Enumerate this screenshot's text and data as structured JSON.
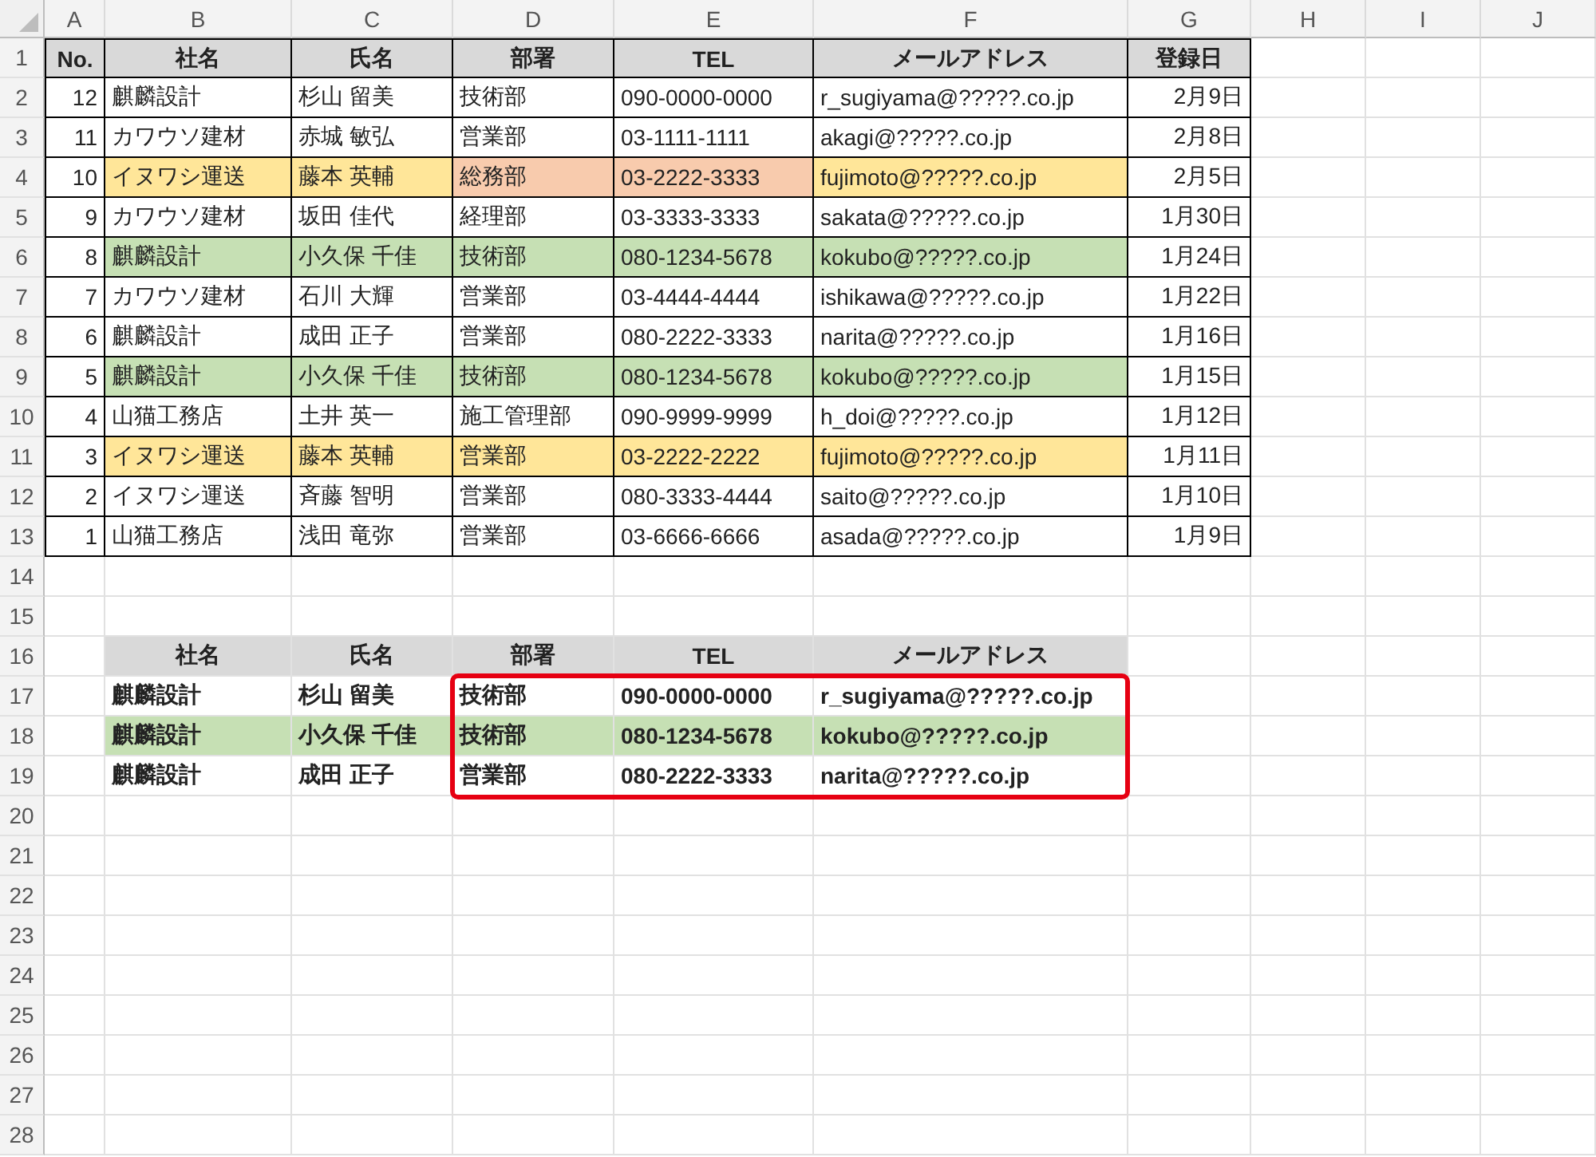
{
  "column_headers": [
    "A",
    "B",
    "C",
    "D",
    "E",
    "F",
    "G",
    "H",
    "I",
    "J"
  ],
  "row_headers": [
    "1",
    "2",
    "3",
    "4",
    "5",
    "6",
    "7",
    "8",
    "9",
    "10",
    "11",
    "12",
    "13",
    "14",
    "15",
    "16",
    "17",
    "18",
    "19",
    "20",
    "21",
    "22",
    "23",
    "24",
    "25",
    "26",
    "27",
    "28"
  ],
  "table_1": {
    "header": [
      "No.",
      "社名",
      "氏名",
      "部署",
      "TEL",
      "メールアドレス",
      "登録日"
    ],
    "rows": [
      {
        "cells": [
          {
            "text": "12"
          },
          {
            "text": "麒麟設計"
          },
          {
            "text": "杉山 留美"
          },
          {
            "text": "技術部"
          },
          {
            "text": "090-0000-0000"
          },
          {
            "text": "r_sugiyama@?????.co.jp"
          },
          {
            "text": "2月9日"
          }
        ]
      },
      {
        "cells": [
          {
            "text": "11"
          },
          {
            "text": "カワウソ建材"
          },
          {
            "text": "赤城 敏弘"
          },
          {
            "text": "営業部"
          },
          {
            "text": "03-1111-1111"
          },
          {
            "text": "akagi@?????.co.jp"
          },
          {
            "text": "2月8日"
          }
        ]
      },
      {
        "cells": [
          {
            "text": "10"
          },
          {
            "text": "イヌワシ運送",
            "color": "#ffe699"
          },
          {
            "text": "藤本 英輔",
            "color": "#ffe699"
          },
          {
            "text": "総務部",
            "color": "#f8cbad"
          },
          {
            "text": "03-2222-3333",
            "color": "#f8cbad"
          },
          {
            "text": "fujimoto@?????.co.jp",
            "color": "#ffe699"
          },
          {
            "text": "2月5日"
          }
        ]
      },
      {
        "cells": [
          {
            "text": "9"
          },
          {
            "text": "カワウソ建材"
          },
          {
            "text": "坂田 佳代"
          },
          {
            "text": "経理部"
          },
          {
            "text": "03-3333-3333"
          },
          {
            "text": "sakata@?????.co.jp"
          },
          {
            "text": "1月30日"
          }
        ]
      },
      {
        "cells": [
          {
            "text": "8"
          },
          {
            "text": "麒麟設計",
            "color": "#c6e0b4"
          },
          {
            "text": "小久保 千佳",
            "color": "#c6e0b4"
          },
          {
            "text": "技術部",
            "color": "#c6e0b4"
          },
          {
            "text": "080-1234-5678",
            "color": "#c6e0b4"
          },
          {
            "text": "kokubo@?????.co.jp",
            "color": "#c6e0b4"
          },
          {
            "text": "1月24日"
          }
        ]
      },
      {
        "cells": [
          {
            "text": "7"
          },
          {
            "text": "カワウソ建材"
          },
          {
            "text": "石川 大輝"
          },
          {
            "text": "営業部"
          },
          {
            "text": "03-4444-4444"
          },
          {
            "text": "ishikawa@?????.co.jp"
          },
          {
            "text": "1月22日"
          }
        ]
      },
      {
        "cells": [
          {
            "text": "6"
          },
          {
            "text": "麒麟設計"
          },
          {
            "text": "成田 正子"
          },
          {
            "text": "営業部"
          },
          {
            "text": "080-2222-3333"
          },
          {
            "text": "narita@?????.co.jp"
          },
          {
            "text": "1月16日"
          }
        ]
      },
      {
        "cells": [
          {
            "text": "5"
          },
          {
            "text": "麒麟設計",
            "color": "#c6e0b4"
          },
          {
            "text": "小久保 千佳",
            "color": "#c6e0b4"
          },
          {
            "text": "技術部",
            "color": "#c6e0b4"
          },
          {
            "text": "080-1234-5678",
            "color": "#c6e0b4"
          },
          {
            "text": "kokubo@?????.co.jp",
            "color": "#c6e0b4"
          },
          {
            "text": "1月15日"
          }
        ]
      },
      {
        "cells": [
          {
            "text": "4"
          },
          {
            "text": "山猫工務店"
          },
          {
            "text": "土井 英一"
          },
          {
            "text": "施工管理部"
          },
          {
            "text": "090-9999-9999"
          },
          {
            "text": "h_doi@?????.co.jp"
          },
          {
            "text": "1月12日"
          }
        ]
      },
      {
        "cells": [
          {
            "text": "3"
          },
          {
            "text": "イヌワシ運送",
            "color": "#ffe699"
          },
          {
            "text": "藤本 英輔",
            "color": "#ffe699"
          },
          {
            "text": "営業部",
            "color": "#ffe699"
          },
          {
            "text": "03-2222-2222",
            "color": "#ffe699"
          },
          {
            "text": "fujimoto@?????.co.jp",
            "color": "#ffe699"
          },
          {
            "text": "1月11日"
          }
        ]
      },
      {
        "cells": [
          {
            "text": "2"
          },
          {
            "text": "イヌワシ運送"
          },
          {
            "text": "斉藤 智明"
          },
          {
            "text": "営業部"
          },
          {
            "text": "080-3333-4444"
          },
          {
            "text": "saito@?????.co.jp"
          },
          {
            "text": "1月10日"
          }
        ]
      },
      {
        "cells": [
          {
            "text": "1"
          },
          {
            "text": "山猫工務店"
          },
          {
            "text": "浅田 竜弥"
          },
          {
            "text": "営業部"
          },
          {
            "text": "03-6666-6666"
          },
          {
            "text": "asada@?????.co.jp"
          },
          {
            "text": "1月9日"
          }
        ]
      }
    ]
  },
  "table_2": {
    "header": [
      "社名",
      "氏名",
      "部署",
      "TEL",
      "メールアドレス"
    ],
    "rows": [
      {
        "cells": [
          {
            "text": "麒麟設計"
          },
          {
            "text": "杉山 留美"
          },
          {
            "text": "技術部"
          },
          {
            "text": "090-0000-0000"
          },
          {
            "text": "r_sugiyama@?????.co.jp"
          }
        ]
      },
      {
        "cells": [
          {
            "text": "麒麟設計",
            "color": "#c6e0b4"
          },
          {
            "text": "小久保 千佳",
            "color": "#c6e0b4"
          },
          {
            "text": "技術部",
            "color": "#c6e0b4"
          },
          {
            "text": "080-1234-5678",
            "color": "#c6e0b4"
          },
          {
            "text": "kokubo@?????.co.jp",
            "color": "#c6e0b4"
          }
        ]
      },
      {
        "cells": [
          {
            "text": "麒麟設計"
          },
          {
            "text": "成田 正子"
          },
          {
            "text": "営業部"
          },
          {
            "text": "080-2222-3333"
          },
          {
            "text": "narita@?????.co.jp"
          }
        ]
      }
    ]
  }
}
